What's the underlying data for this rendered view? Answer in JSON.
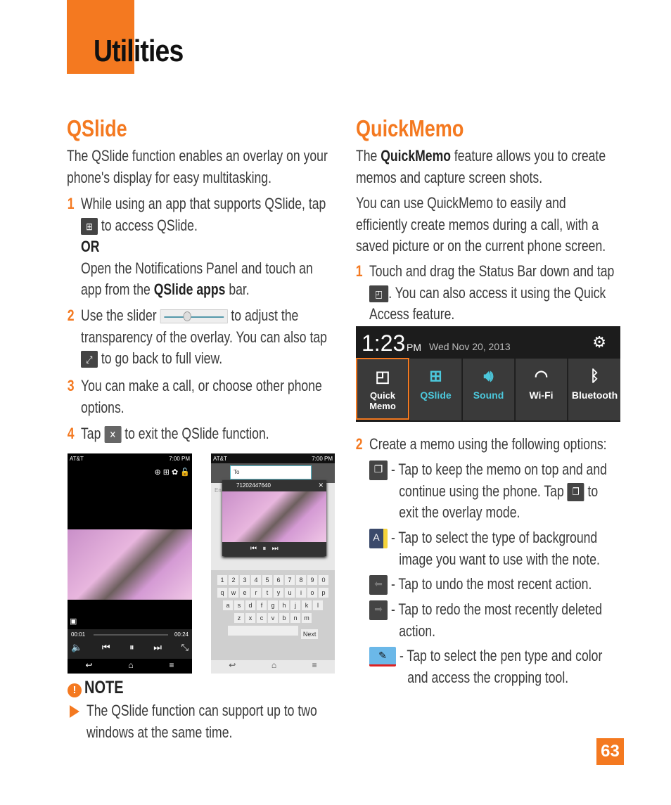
{
  "header": {
    "title": "Utilities",
    "accent": "#F47920"
  },
  "qslide": {
    "heading": "QSlide",
    "intro": [
      "The QSlide function enables an overlay on your",
      "phone's display for easy multitasking."
    ],
    "step1": {
      "num": "1",
      "a": "While using an app that supports QSlide, tap",
      "b": "to access QSlide.",
      "or": "OR",
      "c": "Open the Notifications Panel and touch an",
      "d": "app from the ",
      "d_bold": "QSlide apps",
      "d_end": " bar."
    },
    "step2": {
      "num": "2",
      "a": "Use the slider",
      "b": "to adjust the",
      "c": "transparency of the overlay. You can also tap",
      "d": "to go back to full view."
    },
    "step3": {
      "num": "3",
      "a": "You can make a call, or choose other phone",
      "b": "options."
    },
    "step4": {
      "num": "4",
      "a": "Tap",
      "b": "to exit the QSlide function."
    },
    "screen1": {
      "carrier": "AT&T",
      "time": "7:00 PM",
      "elapsed": "00:01",
      "total": "00:24"
    },
    "screen2": {
      "carrier": "AT&T",
      "time": "7:00 PM",
      "to": "To",
      "number": "71202447640",
      "enter": "En",
      "next": "Next",
      "digits": [
        "1",
        "2",
        "3",
        "4",
        "5",
        "6",
        "7",
        "8",
        "9",
        "0"
      ],
      "row1": [
        "q",
        "w",
        "e",
        "r",
        "t",
        "y",
        "u",
        "i",
        "o",
        "p"
      ],
      "row2": [
        "a",
        "s",
        "d",
        "f",
        "g",
        "h",
        "j",
        "k",
        "l"
      ],
      "row3": [
        "z",
        "x",
        "c",
        "v",
        "b",
        "n",
        "m"
      ]
    },
    "note": {
      "label": "NOTE",
      "text": [
        "The QSlide function can support up to two",
        "windows at the same time."
      ]
    }
  },
  "quickmemo": {
    "heading": "QuickMemo",
    "p1_pre": "The ",
    "p1_bold": "QuickMemo",
    "p1_post": " feature allows you to create",
    "p1_b": "memos and capture screen shots.",
    "p2": [
      "You can use QuickMemo to easily and",
      "efficiently create memos during a call, with a",
      "saved picture or on the current phone screen."
    ],
    "step1": {
      "num": "1",
      "a": "Touch and drag the Status Bar down and tap",
      "b": ". You can also access it using the Quick",
      "c": "Access feature."
    },
    "panel": {
      "time": "1:23",
      "ampm": "PM",
      "date": "Wed Nov 20, 2013",
      "tiles": [
        "Quick Memo",
        "QSlide",
        "Sound",
        "Wi-Fi",
        "Bluetooth"
      ]
    },
    "step2": {
      "num": "2",
      "a": "Create a memo using the following options:"
    },
    "options": [
      {
        "icon": "overlay-icon",
        "lines": [
          "- Tap to keep the memo on top and and",
          "continue using the phone. Tap",
          "to",
          "exit the overlay mode."
        ]
      },
      {
        "icon": "background-icon",
        "lines": [
          "- Tap to select the type of background",
          "image you want to use with the note."
        ]
      },
      {
        "icon": "undo-icon",
        "lines": [
          "- Tap to undo the most recent action."
        ]
      },
      {
        "icon": "redo-icon",
        "lines": [
          "- Tap to redo the most recently deleted",
          "action."
        ]
      },
      {
        "icon": "pen-icon",
        "lines": [
          "- Tap to select the pen type and color",
          "and access the cropping tool."
        ]
      }
    ]
  },
  "page_number": "63"
}
